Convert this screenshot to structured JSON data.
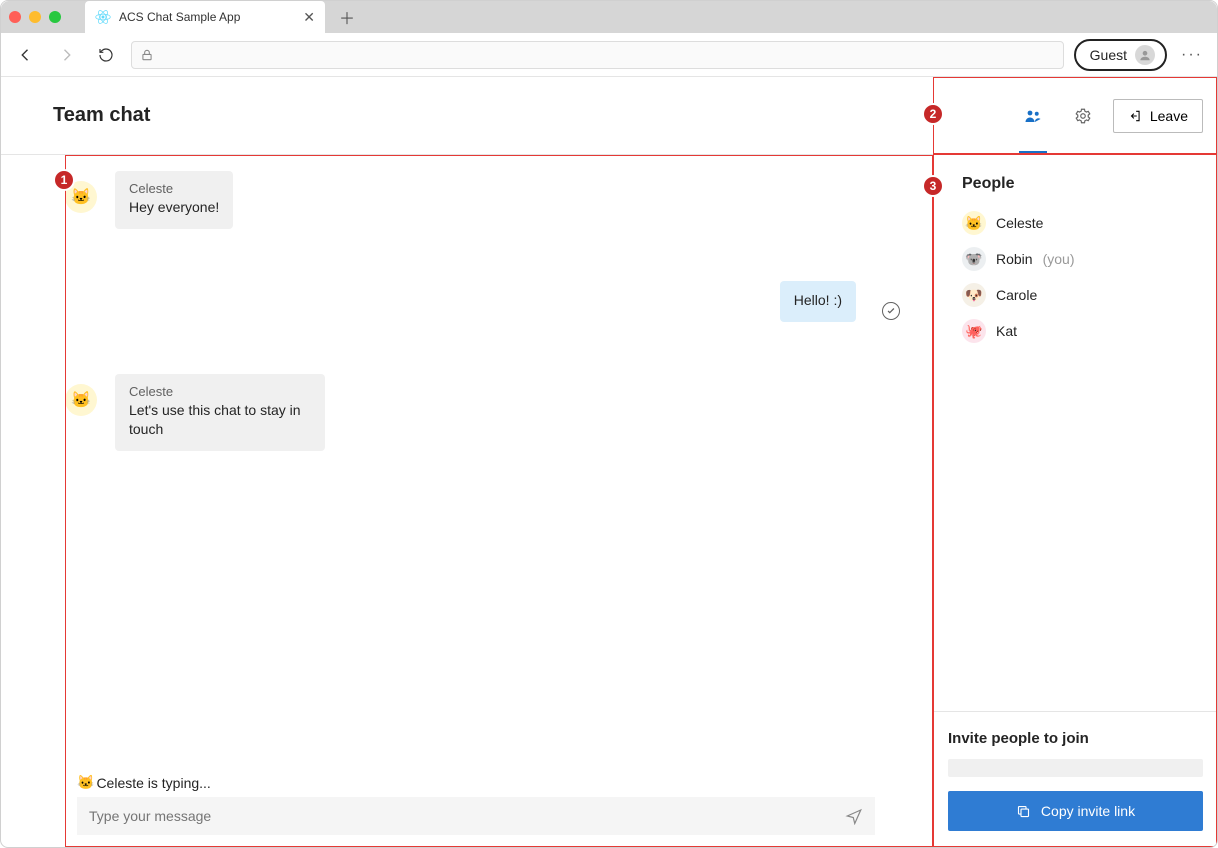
{
  "browser": {
    "tab_title": "ACS Chat Sample App",
    "guest_label": "Guest"
  },
  "header": {
    "title": "Team chat",
    "leave_label": "Leave"
  },
  "chat": {
    "messages": [
      {
        "author": "Celeste",
        "text": "Hey everyone!",
        "direction": "in",
        "avatar": "🐱"
      },
      {
        "text": "Hello! :)",
        "direction": "out",
        "status": "delivered"
      },
      {
        "author": "Celeste",
        "text": "Let's use this chat to stay in touch",
        "direction": "in",
        "avatar": "🐱"
      }
    ],
    "typing_avatar": "🐱",
    "typing_text": "Celeste is typing...",
    "compose_placeholder": "Type your message"
  },
  "people": {
    "title": "People",
    "list": [
      {
        "name": "Celeste",
        "emoji": "🐱",
        "bg": "#fff7d1"
      },
      {
        "name": "Robin",
        "you": "(you)",
        "emoji": "🐨",
        "bg": "#eceff1"
      },
      {
        "name": "Carole",
        "emoji": "🐶",
        "bg": "#f5f0e6"
      },
      {
        "name": "Kat",
        "emoji": "🐙",
        "bg": "#fce4ec"
      }
    ]
  },
  "invite": {
    "title": "Invite people to join",
    "button_label": "Copy invite link"
  },
  "callouts": {
    "one": "1",
    "two": "2",
    "three": "3"
  }
}
